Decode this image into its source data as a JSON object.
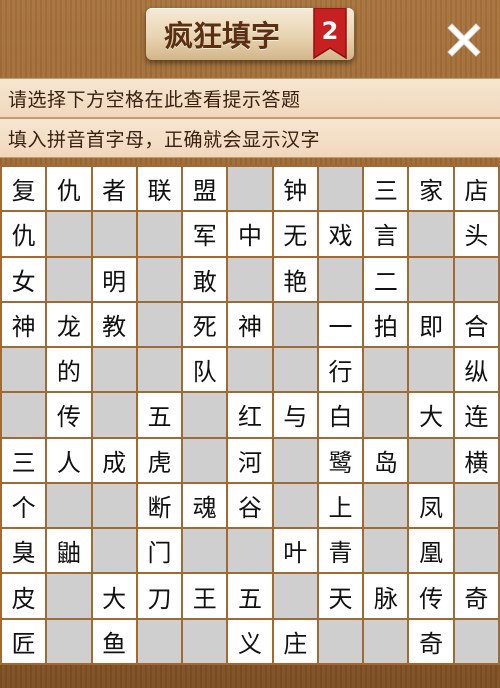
{
  "header": {
    "title": "疯狂填字",
    "level": "2",
    "close_icon": "close-x-icon"
  },
  "hints": {
    "line1": "请选择下方空格在此查看提示答题",
    "line2": "填入拼音首字母，正确就会显示汉字"
  },
  "colors": {
    "cell_white": "#ffffff",
    "cell_block": "#cfcfcf",
    "badge_red": "#c62020",
    "wood": "#9a6834"
  },
  "grid": {
    "rows": [
      [
        "复",
        "仇",
        "者",
        "联",
        "盟",
        "#",
        "钟",
        "#",
        "三",
        "家",
        "店"
      ],
      [
        "仇",
        "#",
        "#",
        "#",
        "军",
        "中",
        "无",
        "戏",
        "言",
        "#",
        "头"
      ],
      [
        "女",
        "#",
        "明",
        "#",
        "敢",
        "#",
        "艳",
        "#",
        "二",
        "#",
        "#"
      ],
      [
        "神",
        "龙",
        "教",
        "#",
        "死",
        "神",
        "#",
        "一",
        "拍",
        "即",
        "合"
      ],
      [
        "#",
        "的",
        "#",
        "#",
        "队",
        "#",
        "#",
        "行",
        "#",
        "#",
        "纵"
      ],
      [
        "#",
        "传",
        "#",
        "五",
        "#",
        "红",
        "与",
        "白",
        "#",
        "大",
        "连"
      ],
      [
        "三",
        "人",
        "成",
        "虎",
        "#",
        "河",
        "#",
        "鹭",
        "岛",
        "#",
        "横"
      ],
      [
        "个",
        "#",
        "#",
        "断",
        "魂",
        "谷",
        "#",
        "上",
        "#",
        "凤",
        "#"
      ],
      [
        "臭",
        "鼬",
        "#",
        "门",
        "#",
        "#",
        "叶",
        "青",
        "#",
        "凰",
        "#"
      ],
      [
        "皮",
        "#",
        "大",
        "刀",
        "王",
        "五",
        "#",
        "天",
        "脉",
        "传",
        "奇"
      ],
      [
        "匠",
        "#",
        "鱼",
        "#",
        "#",
        "义",
        "庄",
        "#",
        "#",
        "奇",
        "#"
      ]
    ]
  }
}
